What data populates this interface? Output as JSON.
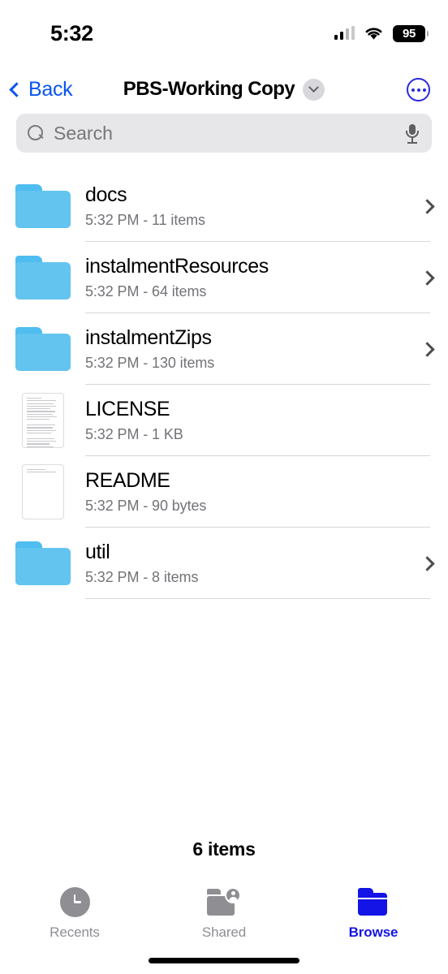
{
  "status_bar": {
    "time": "5:32",
    "cellular_icon": "cellular-bars-icon",
    "wifi_icon": "wifi-icon",
    "battery_percent": "95"
  },
  "nav_bar": {
    "back_label": "Back",
    "back_icon": "chevron-left-icon",
    "title": "PBS-Working Copy",
    "title_menu_icon": "chevron-down-icon",
    "more_icon": "ellipsis-circle-icon"
  },
  "search": {
    "placeholder": "Search",
    "value": "",
    "search_icon": "search-icon",
    "mic_icon": "microphone-icon"
  },
  "files": [
    {
      "name": "docs",
      "subtitle": "5:32 PM - 11 items",
      "kind": "folder",
      "has_disclosure": true
    },
    {
      "name": "instalmentResources",
      "subtitle": "5:32 PM - 64 items",
      "kind": "folder",
      "has_disclosure": true
    },
    {
      "name": "instalmentZips",
      "subtitle": "5:32 PM - 130 items",
      "kind": "folder",
      "has_disclosure": true
    },
    {
      "name": "LICENSE",
      "subtitle": "5:32 PM - 1 KB",
      "kind": "document",
      "has_disclosure": false
    },
    {
      "name": "README",
      "subtitle": "5:32 PM - 90 bytes",
      "kind": "document",
      "has_disclosure": false
    },
    {
      "name": "util",
      "subtitle": "5:32 PM - 8 items",
      "kind": "folder",
      "has_disclosure": true
    }
  ],
  "footer": {
    "item_count": "6 items"
  },
  "tab_bar": {
    "tabs": [
      {
        "label": "Recents",
        "icon": "clock-icon",
        "active": false
      },
      {
        "label": "Shared",
        "icon": "shared-folder-person-icon",
        "active": false
      },
      {
        "label": "Browse",
        "icon": "folder-icon",
        "active": true
      }
    ]
  },
  "colors": {
    "accent_blue": "#0a55f0",
    "tab_active_blue": "#1414e6",
    "folder_blue": "#63c4f0",
    "separator": "#d6d6d8",
    "search_bg": "#e7e7e9",
    "secondary_text": "#737378"
  }
}
